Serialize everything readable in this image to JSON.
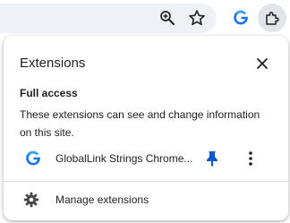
{
  "toolbar": {
    "icons": [
      "zoom-icon",
      "bookmark-star-icon",
      "globallink-extension-icon",
      "extensions-puzzle-icon"
    ]
  },
  "popup": {
    "title": "Extensions",
    "close_icon": "close-icon",
    "full_access": {
      "heading": "Full access",
      "description": "These extensions can see and change information on this site."
    },
    "extensions": [
      {
        "name": "GlobalLink Strings Chrome...",
        "icon": "globallink-g-icon",
        "pinned": true,
        "pin_color": "#0b57d0"
      }
    ],
    "manage": {
      "label": "Manage extensions",
      "icon": "gear-icon"
    }
  },
  "colors": {
    "accent": "#0b57d0",
    "omnibox_bg": "#eef1f6",
    "active_button_bg": "#e1e5ea"
  }
}
